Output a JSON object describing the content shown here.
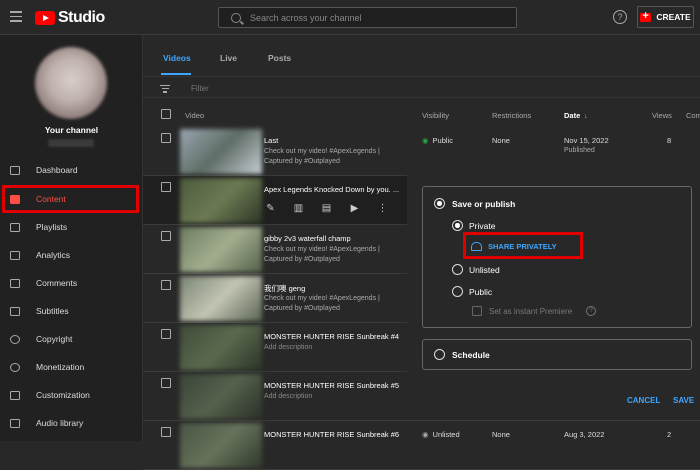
{
  "topbar": {
    "logo_text": "Studio",
    "search_placeholder": "Search across your channel",
    "help_glyph": "?",
    "create_label": "CREATE"
  },
  "sidebar": {
    "channel_title": "Your channel",
    "items": [
      {
        "label": "Dashboard",
        "icon": "dashboard-icon"
      },
      {
        "label": "Content",
        "icon": "content-icon",
        "active": true
      },
      {
        "label": "Playlists",
        "icon": "playlists-icon"
      },
      {
        "label": "Analytics",
        "icon": "analytics-icon"
      },
      {
        "label": "Comments",
        "icon": "comments-icon"
      },
      {
        "label": "Subtitles",
        "icon": "subtitles-icon"
      },
      {
        "label": "Copyright",
        "icon": "copyright-icon"
      },
      {
        "label": "Monetization",
        "icon": "monetization-icon"
      },
      {
        "label": "Customization",
        "icon": "customization-icon"
      },
      {
        "label": "Audio library",
        "icon": "audio-library-icon"
      }
    ]
  },
  "tabs": [
    "Videos",
    "Live",
    "Posts"
  ],
  "filter_placeholder": "Filter",
  "columns": {
    "video": "Video",
    "visibility": "Visibility",
    "restrictions": "Restrictions",
    "date": "Date",
    "date_sort": "↓",
    "views": "Views",
    "comments": "Com"
  },
  "rows": [
    {
      "title": "Last",
      "desc": "Check out my video! #ApexLegends | Captured by #Outplayed",
      "visibility": "Public",
      "restrictions": "None",
      "date": "Nov 15, 2022",
      "date_sub": "Published",
      "views": "8"
    },
    {
      "title": "Apex Legends Knocked Down by you. ...",
      "desc": ""
    },
    {
      "title": "gibby 2v3 waterfall champ",
      "desc": "Check out my video! #ApexLegends | Captured by #Outplayed"
    },
    {
      "title": "我们噢 geng",
      "desc": "Check out my video! #ApexLegends | Captured by #Outplayed"
    },
    {
      "title": "MONSTER HUNTER RISE Sunbreak #4",
      "desc": "Add description"
    },
    {
      "title": "MONSTER HUNTER RISE Sunbreak #5",
      "desc": "Add description"
    },
    {
      "title": "MONSTER HUNTER RISE Sunbreak #6",
      "desc": "",
      "visibility": "Unlisted",
      "restrictions": "None",
      "date": "Aug 3, 2022",
      "views": "2"
    }
  ],
  "row_icon_glyphs": [
    "✎",
    "▥",
    "▤",
    "▶",
    "⋮"
  ],
  "visibility_glyph": "◉",
  "dialog": {
    "save_or_publish": "Save or publish",
    "private": "Private",
    "share_privately": "SHARE PRIVATELY",
    "unlisted": "Unlisted",
    "public": "Public",
    "instant_premiere": "Set as instant Premiere",
    "info_glyph": "?",
    "schedule": "Schedule",
    "cancel": "CANCEL",
    "save": "SAVE"
  },
  "colors": {
    "accent": "#3ea6ff",
    "brand_red": "#ff0000",
    "highlight_box": "#e00000",
    "public_green": "#2ba640"
  }
}
